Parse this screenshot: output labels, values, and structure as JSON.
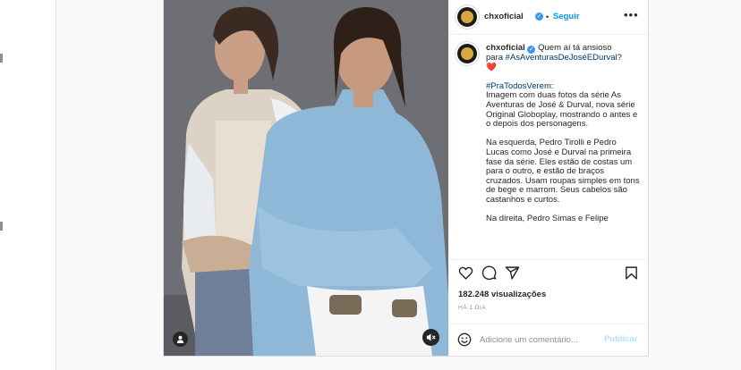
{
  "post": {
    "username": "chxoficial",
    "follow_label": "Seguir",
    "more_label": "•••",
    "caption": {
      "line1": "Quem aí tá ansioso",
      "line2_prefix": "para ",
      "hashtag1": "#AsAventurasDeJoséEDurval",
      "line2_suffix": "?",
      "heart": "❤️",
      "hashtag2": "#PraTodosVerem",
      "hashtag2_suffix": ":",
      "para1": "Imagem com duas fotos da série As Aventuras de José & Durval, nova série Original Globoplay, mostrando o antes e o depois dos personagens.",
      "para2": "Na esquerda, Pedro Tirolli e Pedro Lucas como José e Durval na primeira fase da série. Eles estão de costas um para o outro, e estão de braços cruzados. Usam roupas simples em tons de bege e marrom. Seus cabelos são castanhos e curtos.",
      "para3": "Na direita, Pedro Simas e Felipe"
    },
    "views": "182.248 visualizações",
    "date": "HÁ 1 DIA",
    "comment_placeholder": "Adicione um comentário...",
    "publish_label": "Publicar"
  },
  "icons": [
    "verified-badge-icon",
    "heart-icon",
    "comment-icon",
    "share-icon",
    "bookmark-icon",
    "emoji-icon",
    "user-tag-icon",
    "mute-icon"
  ],
  "colors": {
    "link": "#00376b",
    "follow": "#0095f6",
    "publish_disabled": "#b2dffc",
    "verified": "#3897f0",
    "secondary_text": "#8e8e8e"
  }
}
